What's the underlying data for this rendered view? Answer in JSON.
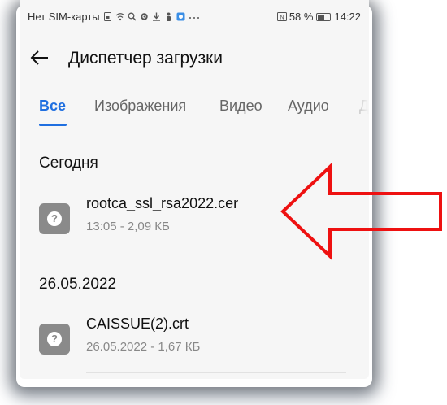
{
  "status_bar": {
    "left_text": "Нет SIM-карты",
    "icons": [
      "sim-icon",
      "wifi-icon",
      "search-icon",
      "settings-icon",
      "download-icon",
      "person-icon",
      "app-icon",
      "more-icon"
    ],
    "signal_label": "",
    "battery_percent": "58 %",
    "time": "14:22"
  },
  "header": {
    "title": "Диспетчер загрузки"
  },
  "tabs": [
    {
      "label": "Все",
      "active": true
    },
    {
      "label": "Изображения",
      "active": false
    },
    {
      "label": "Видео",
      "active": false
    },
    {
      "label": "Аудио",
      "active": false
    },
    {
      "label": "Д",
      "active": false
    }
  ],
  "sections": [
    {
      "header": "Сегодня",
      "items": [
        {
          "name": "rootca_ssl_rsa2022.cer",
          "meta": "13:05 - 2,09 КБ"
        }
      ]
    },
    {
      "header": "26.05.2022",
      "items": [
        {
          "name": "CAISSUE(2).crt",
          "meta": "26.05.2022 - 1,67 КБ"
        }
      ]
    }
  ],
  "icon_glyph": "?",
  "colors": {
    "accent": "#1f6fe0",
    "annotation": "#ee1111",
    "file_icon": "#8a8a8a"
  }
}
